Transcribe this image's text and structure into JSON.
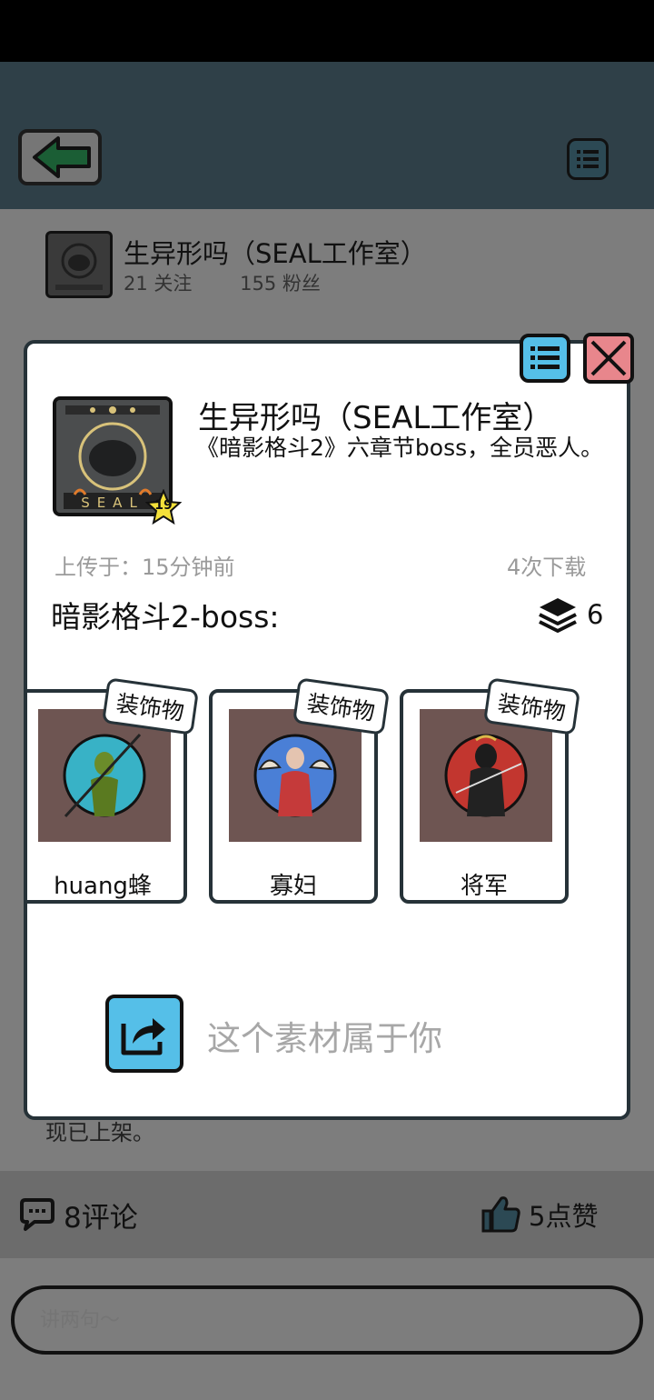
{
  "author": {
    "name": "生异形吗（SEAL工作室）",
    "following": "21 关注",
    "followers": "155 粉丝"
  },
  "background_snippet": "现已上架。",
  "footer": {
    "comments": "8评论",
    "likes": "5点赞"
  },
  "comment_input": {
    "placeholder": "讲两句～"
  },
  "modal": {
    "title": "生异形吗（SEAL工作室）",
    "description": "《暗影格斗2》六章节boss，全员恶人。",
    "level": "19",
    "thumb_text": "SEAL",
    "upload_time": "上传于：15分钟前",
    "downloads": "4次下载",
    "collection_title": "暗影格斗2-boss:",
    "item_count": "6",
    "items": [
      {
        "name": "huang蜂",
        "tag": "装饰物"
      },
      {
        "name": "寡妇",
        "tag": "装饰物"
      },
      {
        "name": "将军",
        "tag": "装饰物"
      }
    ],
    "share_text": "这个素材属于你"
  },
  "colors": {
    "accent_blue": "#55bfe8",
    "close_red": "#e8868c",
    "card_bg": "#6e5552",
    "dim_overlay": "#7d7d7d"
  },
  "icons": [
    "back-arrow-icon",
    "list-menu-icon",
    "close-icon",
    "layers-icon",
    "share-icon",
    "comment-icon",
    "thumbs-up-icon",
    "star-icon"
  ]
}
